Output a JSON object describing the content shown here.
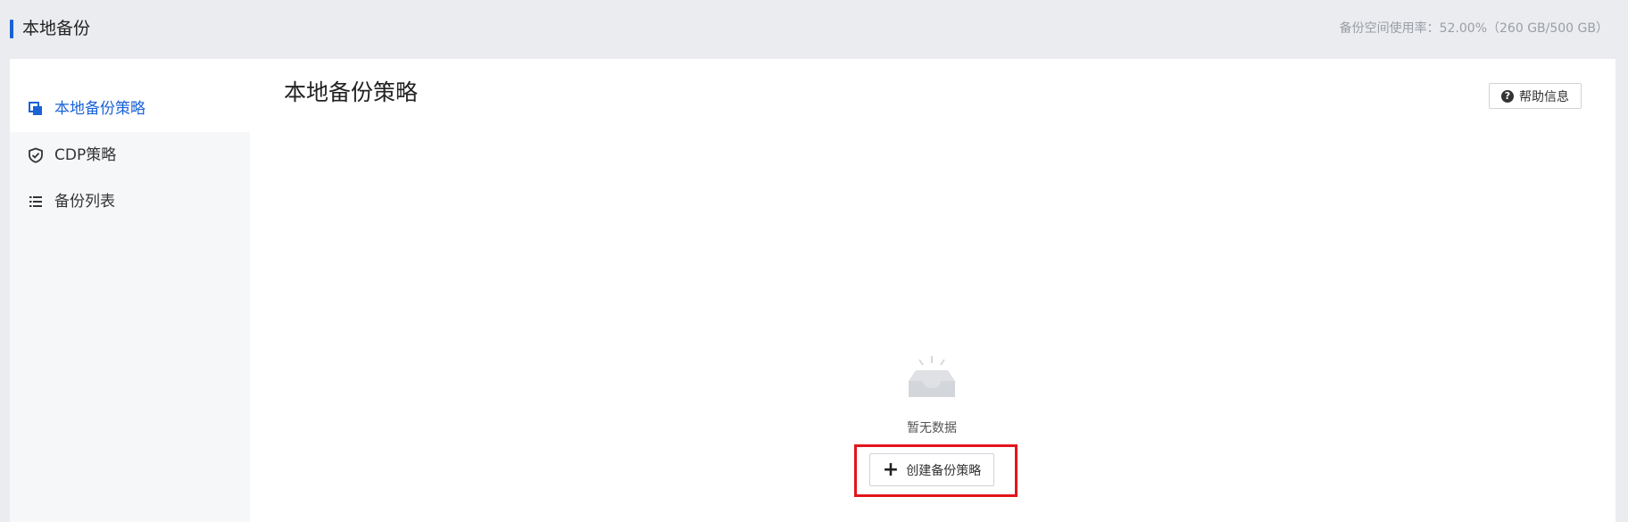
{
  "header": {
    "title": "本地备份",
    "usage_text": "备份空间使用率：52.00%（260 GB/500 GB）",
    "accent_color": "#1a62d6"
  },
  "sidebar": {
    "items": [
      {
        "label": "本地备份策略",
        "icon": "copy-icon",
        "active": true
      },
      {
        "label": "CDP策略",
        "icon": "shield-check-icon",
        "active": false
      },
      {
        "label": "备份列表",
        "icon": "list-icon",
        "active": false
      }
    ]
  },
  "main": {
    "title": "本地备份策略",
    "help_button_label": "帮助信息",
    "help_icon": "question-circle-icon",
    "empty_state": {
      "icon": "empty-box-icon",
      "text": "暂无数据",
      "create_button_label": "创建备份策略",
      "create_icon": "plus-icon"
    }
  },
  "colors": {
    "highlight": "#e3141b",
    "active_nav": "#1a62d6"
  }
}
